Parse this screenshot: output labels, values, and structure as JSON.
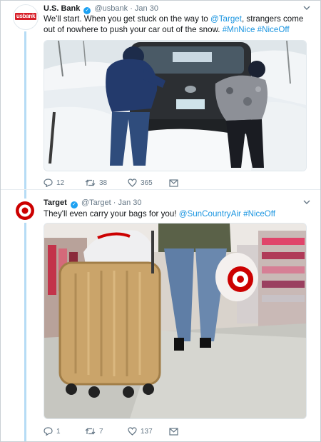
{
  "tweets": [
    {
      "author_name": "U.S. Bank",
      "handle": "@usbank",
      "separator": "·",
      "date": "Jan 30",
      "avatar_text": "usbank",
      "text_plain": "We'll start. When you get stuck on the way to ",
      "text_mention": "@Target",
      "text_plain2": ", strangers come out of nowhere to push your car out of the snow. ",
      "text_tags": "#MnNice #NiceOff",
      "replies": "12",
      "retweets": "38",
      "likes": "365",
      "media_desc": "two people pushing a car stuck in snow"
    },
    {
      "author_name": "Target",
      "handle": "@Target",
      "separator": "·",
      "date": "Jan 30",
      "text_plain": "They'll even carry your bags for you! ",
      "text_mention": "@SunCountryAir",
      "text_plain2": " ",
      "text_tags": "#NiceOff",
      "replies": "1",
      "retweets": "7",
      "likes": "137",
      "media_desc": "person pulling gold suitcase with Target bags in store"
    }
  ],
  "colors": {
    "link": "#1b95e0",
    "verified": "#1da1f2",
    "usbank_red": "#d71e28",
    "target_red": "#cc0000",
    "thread_line": "#b6dcf5"
  },
  "icons": [
    "reply-icon",
    "retweet-icon",
    "like-icon",
    "dm-icon",
    "chevron-down-icon",
    "verified-badge-icon"
  ]
}
